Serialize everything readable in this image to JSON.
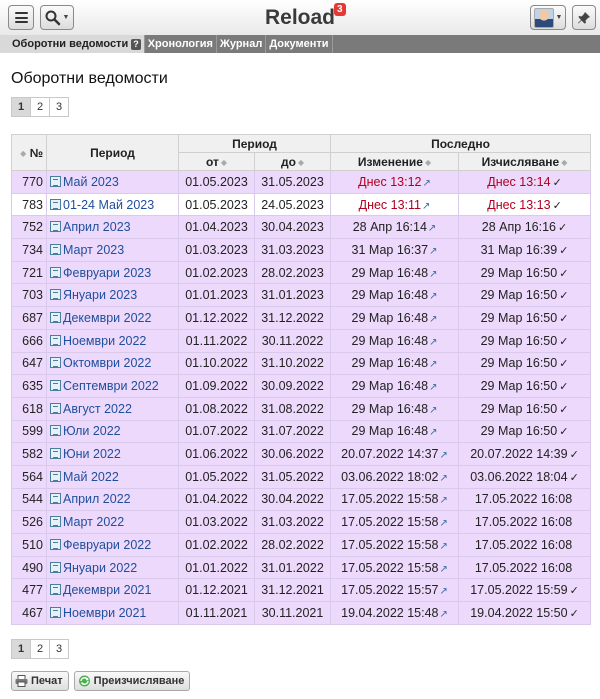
{
  "header": {
    "app_title": "Reload",
    "notification_count": "3"
  },
  "tabs": [
    {
      "label": "Оборотни ведомости",
      "help": "?"
    },
    {
      "label": "Хронология"
    },
    {
      "label": "Журнал"
    },
    {
      "label": "Документи"
    }
  ],
  "page_title": "Оборотни ведомости",
  "pagination": {
    "pages": [
      "1",
      "2",
      "3"
    ],
    "current": "1"
  },
  "table": {
    "headers": {
      "num": "№",
      "period": "Период",
      "period_group": "Период",
      "from": "от",
      "to": "до",
      "last_group": "Последно",
      "change": "Изменение",
      "calc": "Изчисляване"
    },
    "rows": [
      {
        "num": "770",
        "period": "Май 2023",
        "from": "01.05.2023",
        "to": "31.05.2023",
        "change": "Днес 13:12",
        "calc": "Днес 13:14",
        "checked": "✓",
        "highlight": true
      },
      {
        "num": "783",
        "period": "01-24 Май 2023",
        "from": "01.05.2023",
        "to": "24.05.2023",
        "change": "Днес 13:11",
        "calc": "Днес 13:13",
        "checked": "✓",
        "highlight": true,
        "white": true
      },
      {
        "num": "752",
        "period": "Април 2023",
        "from": "01.04.2023",
        "to": "30.04.2023",
        "change": "28 Апр 16:14",
        "calc": "28 Апр 16:16",
        "checked": "✓"
      },
      {
        "num": "734",
        "period": "Март 2023",
        "from": "01.03.2023",
        "to": "31.03.2023",
        "change": "31 Мар 16:37",
        "calc": "31 Мар 16:39",
        "checked": "✓"
      },
      {
        "num": "721",
        "period": "Февруари 2023",
        "from": "01.02.2023",
        "to": "28.02.2023",
        "change": "29 Мар 16:48",
        "calc": "29 Мар 16:50",
        "checked": "✓"
      },
      {
        "num": "703",
        "period": "Януари 2023",
        "from": "01.01.2023",
        "to": "31.01.2023",
        "change": "29 Мар 16:48",
        "calc": "29 Мар 16:50",
        "checked": "✓"
      },
      {
        "num": "687",
        "period": "Декември 2022",
        "from": "01.12.2022",
        "to": "31.12.2022",
        "change": "29 Мар 16:48",
        "calc": "29 Мар 16:50",
        "checked": "✓"
      },
      {
        "num": "666",
        "period": "Ноември 2022",
        "from": "01.11.2022",
        "to": "30.11.2022",
        "change": "29 Мар 16:48",
        "calc": "29 Мар 16:50",
        "checked": "✓"
      },
      {
        "num": "647",
        "period": "Октомври 2022",
        "from": "01.10.2022",
        "to": "31.10.2022",
        "change": "29 Мар 16:48",
        "calc": "29 Мар 16:50",
        "checked": "✓"
      },
      {
        "num": "635",
        "period": "Септември 2022",
        "from": "01.09.2022",
        "to": "30.09.2022",
        "change": "29 Мар 16:48",
        "calc": "29 Мар 16:50",
        "checked": "✓"
      },
      {
        "num": "618",
        "period": "Август 2022",
        "from": "01.08.2022",
        "to": "31.08.2022",
        "change": "29 Мар 16:48",
        "calc": "29 Мар 16:50",
        "checked": "✓"
      },
      {
        "num": "599",
        "period": "Юли 2022",
        "from": "01.07.2022",
        "to": "31.07.2022",
        "change": "29 Мар 16:48",
        "calc": "29 Мар 16:50",
        "checked": "✓"
      },
      {
        "num": "582",
        "period": "Юни 2022",
        "from": "01.06.2022",
        "to": "30.06.2022",
        "change": "20.07.2022 14:37",
        "calc": "20.07.2022 14:39",
        "checked": "✓"
      },
      {
        "num": "564",
        "period": "Май 2022",
        "from": "01.05.2022",
        "to": "31.05.2022",
        "change": "03.06.2022 18:02",
        "calc": "03.06.2022 18:04",
        "checked": "✓"
      },
      {
        "num": "544",
        "period": "Април 2022",
        "from": "01.04.2022",
        "to": "30.04.2022",
        "change": "17.05.2022 15:58",
        "calc": "17.05.2022 16:08",
        "checked": ""
      },
      {
        "num": "526",
        "period": "Март 2022",
        "from": "01.03.2022",
        "to": "31.03.2022",
        "change": "17.05.2022 15:58",
        "calc": "17.05.2022 16:08",
        "checked": ""
      },
      {
        "num": "510",
        "period": "Февруари 2022",
        "from": "01.02.2022",
        "to": "28.02.2022",
        "change": "17.05.2022 15:58",
        "calc": "17.05.2022 16:08",
        "checked": ""
      },
      {
        "num": "490",
        "period": "Януари 2022",
        "from": "01.01.2022",
        "to": "31.01.2022",
        "change": "17.05.2022 15:58",
        "calc": "17.05.2022 16:08",
        "checked": ""
      },
      {
        "num": "477",
        "period": "Декември 2021",
        "from": "01.12.2021",
        "to": "31.12.2021",
        "change": "17.05.2022 15:57",
        "calc": "17.05.2022 15:59",
        "checked": "✓"
      },
      {
        "num": "467",
        "period": "Ноември 2021",
        "from": "01.11.2021",
        "to": "30.11.2021",
        "change": "19.04.2022 15:48",
        "calc": "19.04.2022 15:50",
        "checked": "✓"
      }
    ]
  },
  "actions": {
    "print": "Печат",
    "recalc": "Преизчисляване"
  },
  "colors": {
    "row_bg": "#edd9fb",
    "link": "#1f4f9c",
    "today_red": "#b00020",
    "badge": "#e53935"
  }
}
